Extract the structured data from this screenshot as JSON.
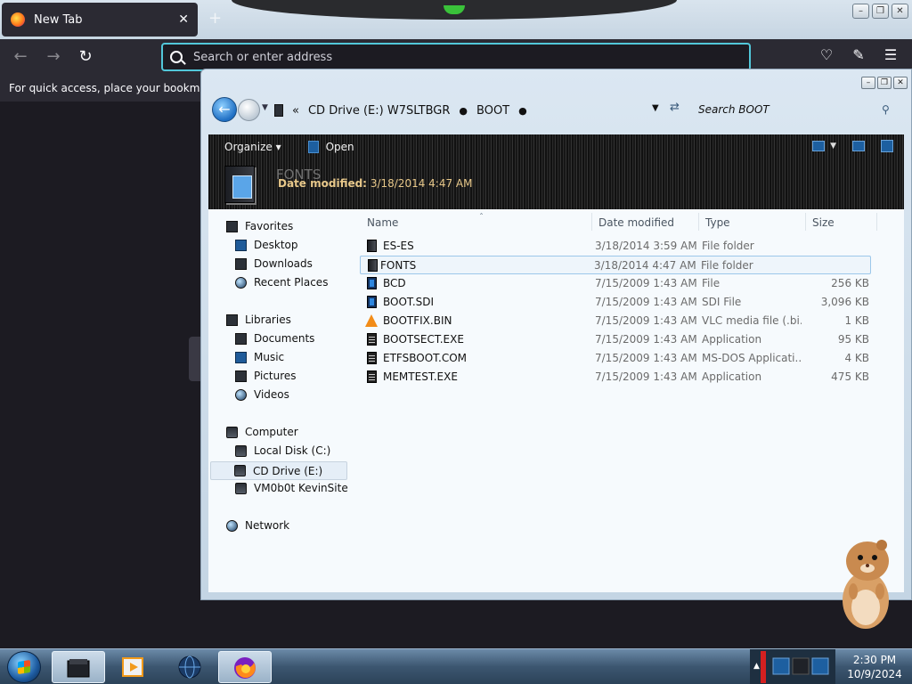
{
  "browser": {
    "tab_title": "New Tab",
    "tab_close": "✕",
    "new_tab": "+",
    "address_placeholder": "Search or enter address",
    "bookmarks_hint": "For quick access, place your bookmarks h"
  },
  "window_buttons": [
    "–",
    "❐",
    "✕"
  ],
  "explorer": {
    "breadcrumb": [
      "CD Drive (E:) W7SLTBGR",
      "BOOT"
    ],
    "breadcrumb_prefix": "«",
    "search_placeholder": "Search BOOT",
    "toolbar": {
      "organize": "Organize ▾",
      "open": "Open"
    },
    "details": {
      "name": "FONTS",
      "modified_label": "Date modified:",
      "modified_value": "3/18/2014 4:47 AM"
    },
    "nav": {
      "favorites": "Favorites",
      "desktop": "Desktop",
      "downloads": "Downloads",
      "recent": "Recent Places",
      "libraries": "Libraries",
      "documents": "Documents",
      "music": "Music",
      "pictures": "Pictures",
      "videos": "Videos",
      "computer": "Computer",
      "local_disk": "Local Disk (C:)",
      "cd_drive": "CD Drive (E:)",
      "vm": "VM0b0t KevinSite",
      "network": "Network"
    },
    "columns": {
      "name": "Name",
      "date": "Date modified",
      "type": "Type",
      "size": "Size"
    },
    "files": [
      {
        "name": "ES-ES",
        "date": "3/18/2014 3:59 AM",
        "type": "File folder",
        "size": "",
        "icon": "folder-icon"
      },
      {
        "name": "FONTS",
        "date": "3/18/2014 4:47 AM",
        "type": "File folder",
        "size": "",
        "icon": "folder-icon"
      },
      {
        "name": "BCD",
        "date": "7/15/2009 1:43 AM",
        "type": "File",
        "size": "256 KB",
        "icon": "file-icon"
      },
      {
        "name": "BOOT.SDI",
        "date": "7/15/2009 1:43 AM",
        "type": "SDI File",
        "size": "3,096 KB",
        "icon": "file-icon"
      },
      {
        "name": "BOOTFIX.BIN",
        "date": "7/15/2009 1:43 AM",
        "type": "VLC media file (.bi...",
        "size": "1 KB",
        "icon": "vlc-icon"
      },
      {
        "name": "BOOTSECT.EXE",
        "date": "7/15/2009 1:43 AM",
        "type": "Application",
        "size": "95 KB",
        "icon": "application-icon"
      },
      {
        "name": "ETFSBOOT.COM",
        "date": "7/15/2009 1:43 AM",
        "type": "MS-DOS Applicati...",
        "size": "4 KB",
        "icon": "application-icon"
      },
      {
        "name": "MEMTEST.EXE",
        "date": "7/15/2009 1:43 AM",
        "type": "Application",
        "size": "475 KB",
        "icon": "application-icon"
      }
    ],
    "selected_file": "FONTS"
  },
  "taskbar": {
    "time": "2:30 PM",
    "date": "10/9/2024"
  },
  "colors": {
    "firefox_dark": "#2b2a33",
    "url_focus": "#52c7d9",
    "selection": "#9cc7ea",
    "detail_text": "#e8c88a"
  }
}
